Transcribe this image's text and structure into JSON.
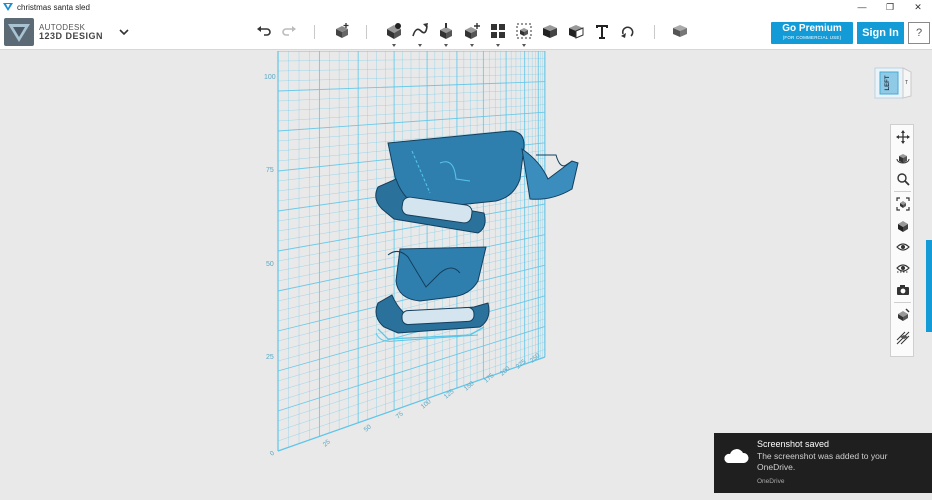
{
  "window": {
    "title": "christmas santa sled",
    "controls": {
      "minimize": "—",
      "maximize": "❐",
      "close": "✕"
    }
  },
  "brand": {
    "line1": "AUTODESK",
    "line2": "123D DESIGN"
  },
  "toolbar": {
    "icons": [
      "undo-icon",
      "redo-icon",
      "add-box-icon",
      "primitives-icon",
      "sketch-icon",
      "construct-icon",
      "modify-icon",
      "pattern-icon",
      "grouping-icon",
      "combine-icon",
      "measure-icon",
      "text-icon",
      "snap-icon",
      "material-icon"
    ],
    "premium_label": "Go Premium",
    "premium_sublabel": "(FOR COMMERCIAL USE)",
    "signin_label": "Sign In",
    "help_label": "?"
  },
  "viewcube": {
    "face_label": "LEFT",
    "side_label": "T"
  },
  "grid": {
    "vertical_ticks": [
      "100",
      "75",
      "50",
      "25"
    ],
    "horizontal_ticks": [
      "0",
      "25",
      "50",
      "75",
      "100",
      "125",
      "150",
      "175",
      "200",
      "225",
      "250"
    ]
  },
  "nav_panel": {
    "icons": [
      "pan-icon",
      "orbit-icon",
      "zoom-icon",
      "fit-icon",
      "view-mode-icon",
      "visibility-icon",
      "hidden-icon",
      "screenshot-icon",
      "material-view-icon",
      "snap-grid-icon"
    ]
  },
  "toast": {
    "title": "Screenshot saved",
    "body": "The screenshot was added to your OneDrive.",
    "source": "OneDrive"
  },
  "colors": {
    "accent": "#129bd6",
    "grid": "#5ec6ea",
    "model": "#2f7fae",
    "model_dark": "#1a4f72"
  }
}
